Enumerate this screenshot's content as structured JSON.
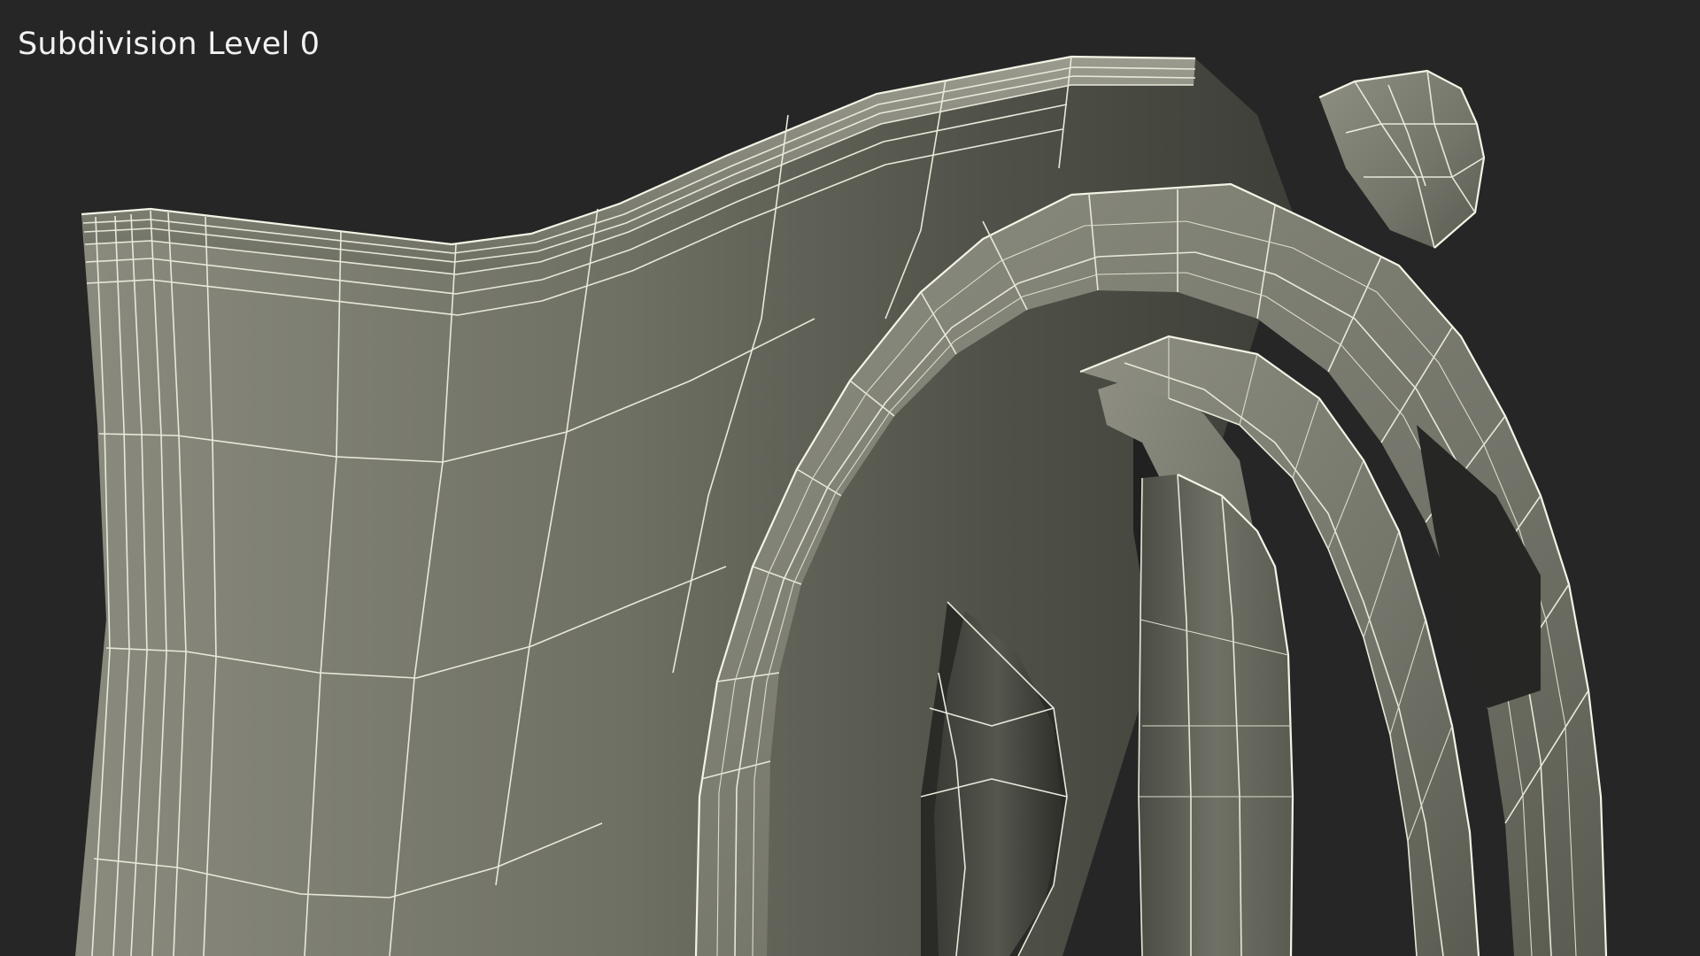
{
  "viewport": {
    "label": "Subdivision Level 0",
    "background_color": "#262626",
    "mesh_color": "#7c7d70",
    "wire_color": "#e8e8da"
  },
  "model": {
    "render_style": "wireframe-on-shaded"
  }
}
